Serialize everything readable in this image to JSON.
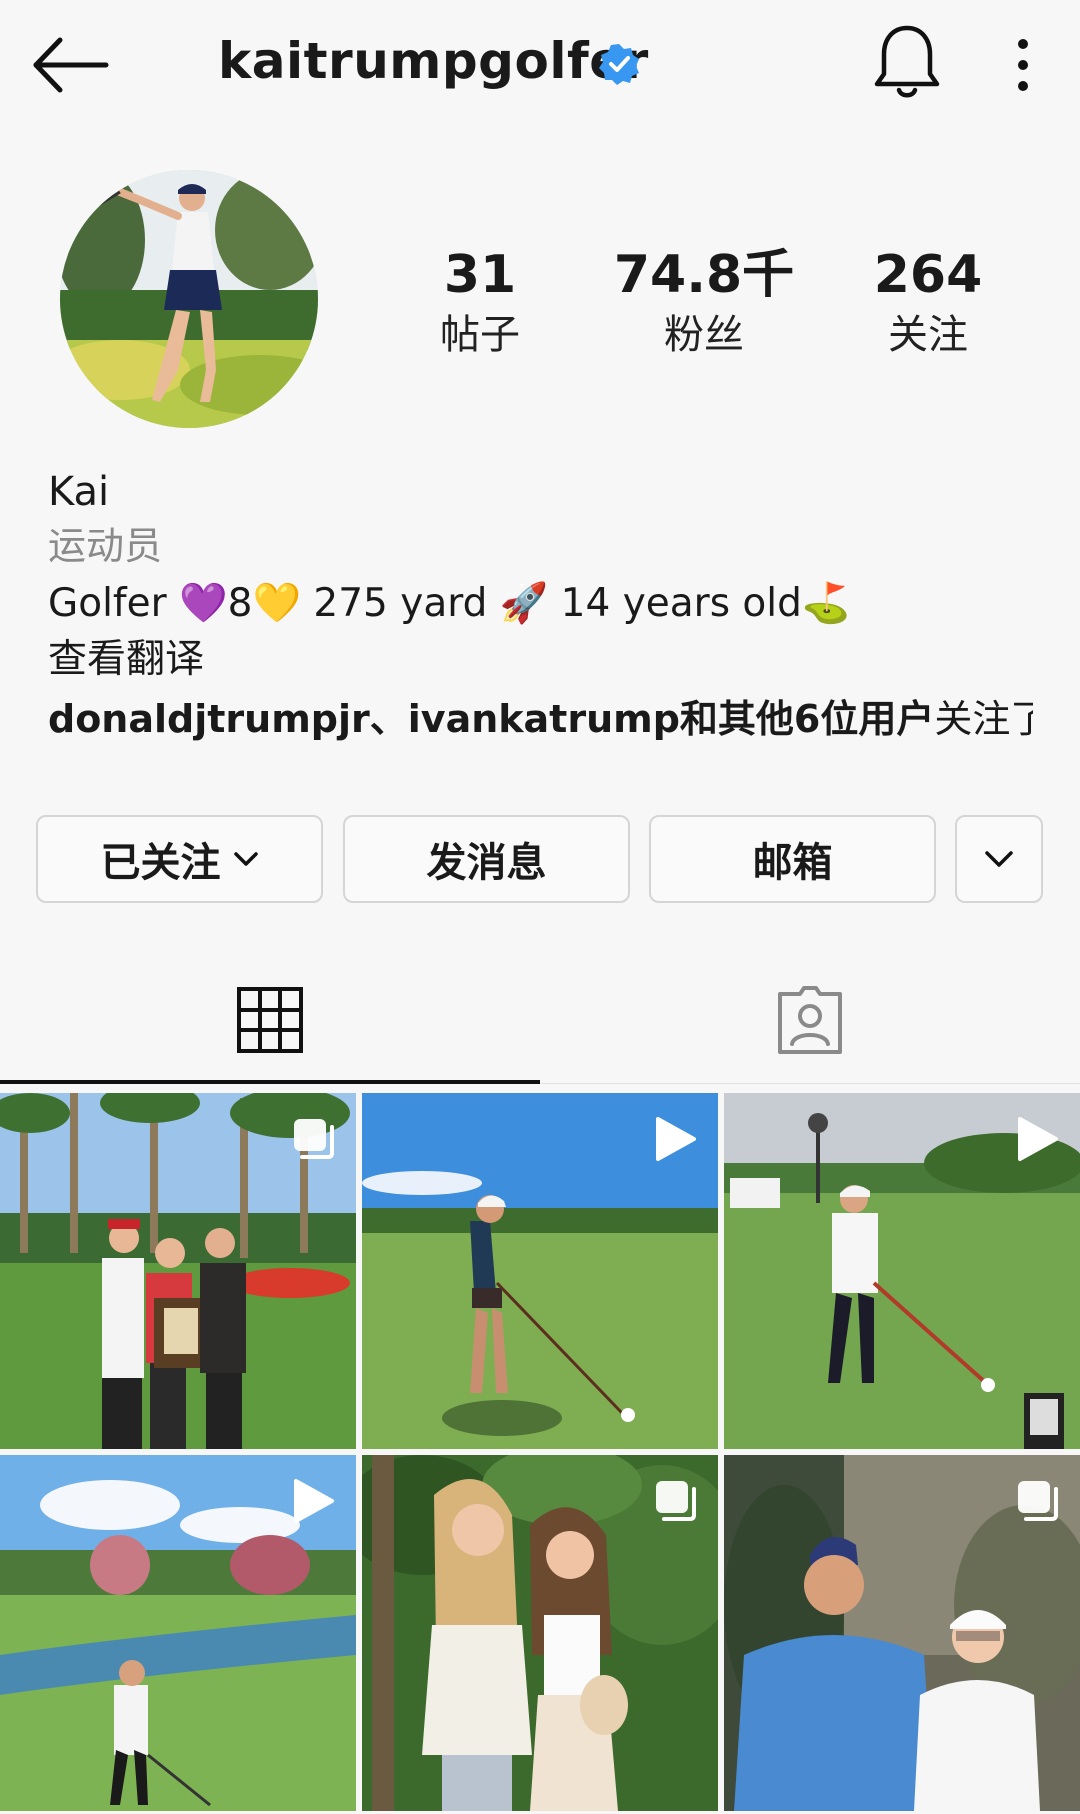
{
  "header": {
    "username": "kaitrumpgolfer",
    "verified": true,
    "icons": [
      "back-arrow-icon",
      "verified-badge-icon",
      "bell-icon",
      "more-vertical-icon"
    ]
  },
  "stats": [
    {
      "value": "31",
      "label": "帖子"
    },
    {
      "value": "74.8千",
      "label": "粉丝"
    },
    {
      "value": "264",
      "label": "关注"
    }
  ],
  "bio": {
    "name": "Kai",
    "category": "运动员",
    "description": "Golfer 💜8💛 275 yard 🚀 14 years old⛳",
    "translate": "查看翻译",
    "followed_by_bold": "donaldjtrumpjr、ivankatrump和其他6位用户",
    "followed_by_suffix": "关注了"
  },
  "buttons": {
    "following": "已关注",
    "message": "发消息",
    "email": "邮箱"
  },
  "tabs": [
    {
      "name": "posts-grid",
      "icon": "grid-icon",
      "active": true
    },
    {
      "name": "tagged",
      "icon": "tagged-person-icon",
      "active": false
    }
  ],
  "colors": {
    "verified": "#3897f0",
    "background": "#f7f7f7"
  },
  "posts": [
    {
      "type": "carousel",
      "badge_icon": "carousel-icon"
    },
    {
      "type": "video",
      "badge_icon": "play-icon"
    },
    {
      "type": "video",
      "badge_icon": "play-icon"
    },
    {
      "type": "video",
      "badge_icon": "play-icon"
    },
    {
      "type": "carousel",
      "badge_icon": "carousel-icon"
    },
    {
      "type": "carousel",
      "badge_icon": "carousel-icon"
    }
  ]
}
